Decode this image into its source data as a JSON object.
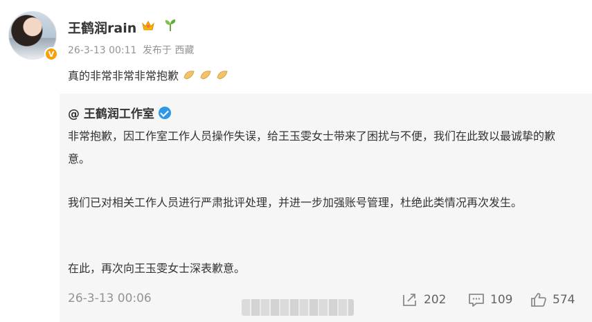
{
  "post": {
    "username": "王鹤润rain",
    "timestamp": "26-3-13 00:11",
    "source": "发布于 西藏",
    "text": "真的非常非常非常抱歉"
  },
  "repost": {
    "author": "@ 王鹤润工作室",
    "paragraphs": [
      "非常抱歉，因工作室工作人员操作失误，给王玉雯女士带来了困扰与不便，我们在此致以最诚挚的歉意。",
      "我们已对相关工作人员进行严肃批评处理，并进一步加强账号管理，杜绝此类情况再次发生。",
      "在此，再次向王玉雯女士深表歉意。"
    ],
    "timestamp": "26-3-13 00:06",
    "actions": {
      "repost_count": "202",
      "comment_count": "109",
      "like_count": "574"
    }
  },
  "colors": {
    "verify_badge": "#f7a10a",
    "verify_check": "#2d98e5",
    "repost_bg": "#f6f6f6",
    "meta_text": "#939393"
  },
  "icons": [
    "avatar",
    "verified-badge-icon",
    "crown-icon",
    "sprout-icon",
    "hand-emoji-icon",
    "blue-verified-icon",
    "repost-icon",
    "comment-icon",
    "like-icon"
  ]
}
